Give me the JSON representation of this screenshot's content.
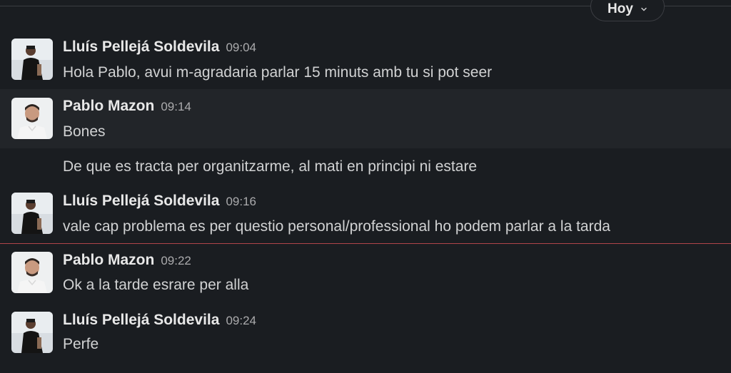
{
  "date_pill": {
    "label": "Hoy",
    "icon": "chevron-down-icon"
  },
  "colors": {
    "background": "#1a1d21",
    "hover_background": "#222529",
    "new_messages_divider": "#b0454a"
  },
  "messages": [
    {
      "author": "Lluís Pellejá Soldevila",
      "time": "09:04",
      "text": "Hola Pablo, avui m-agradaria parlar  15 minuts amb tu si pot seer"
    },
    {
      "author": "Pablo Mazon",
      "time": "09:14",
      "text": "Bones"
    },
    {
      "text": "De que es tracta per organitzarme, al mati en principi ni estare"
    },
    {
      "author": "Lluís Pellejá Soldevila",
      "time": "09:16",
      "text": "vale cap problema es per questio personal/professional ho podem parlar a la tarda"
    },
    {
      "author": "Pablo Mazon",
      "time": "09:22",
      "text": "Ok a la tarde esrare per alla"
    },
    {
      "author": "Lluís Pellejá Soldevila",
      "time": "09:24",
      "text": "Perfe"
    }
  ]
}
